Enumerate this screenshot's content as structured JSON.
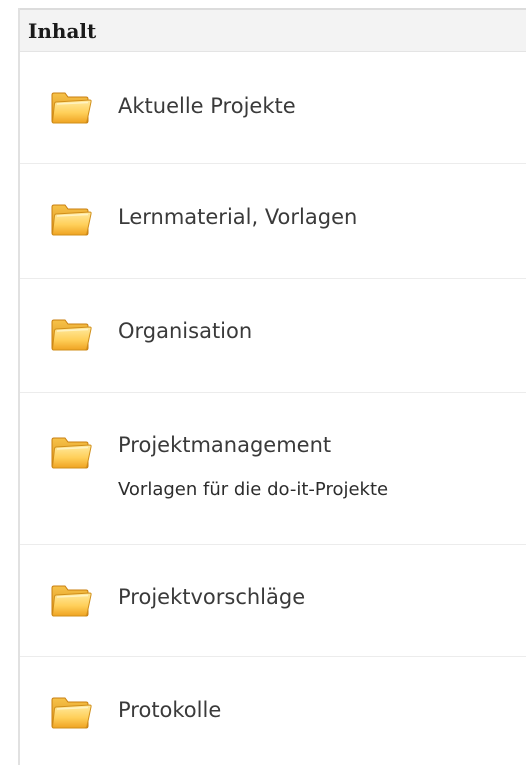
{
  "header": {
    "title": "Inhalt"
  },
  "items": [
    {
      "title": "Aktuelle Projekte",
      "icon": "folder-icon"
    },
    {
      "title": "Lernmaterial, Vorlagen",
      "icon": "folder-icon"
    },
    {
      "title": "Organisation",
      "icon": "folder-icon"
    },
    {
      "title": "Projektmanagement",
      "description": "Vorlagen für die do-it-Projekte",
      "icon": "folder-icon"
    },
    {
      "title": "Projektvorschläge",
      "icon": "folder-icon"
    },
    {
      "title": "Protokolle",
      "icon": "folder-icon"
    }
  ],
  "colors": {
    "folder_light": "#ffe07a",
    "folder_dark": "#e9a21c",
    "text": "#3a3a3a"
  }
}
